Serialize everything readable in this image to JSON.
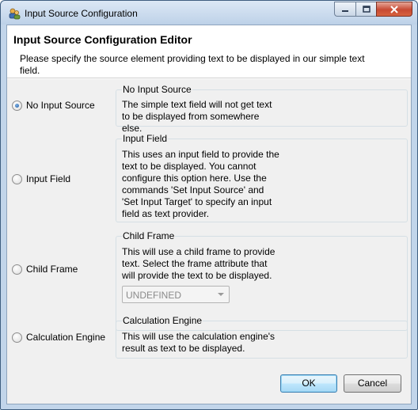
{
  "window": {
    "title": "Input Source Configuration",
    "icons": {
      "app": "app-icon",
      "minimize": "minimize-icon",
      "maximize": "maximize-icon",
      "close": "close-icon"
    }
  },
  "header": {
    "title": "Input Source Configuration Editor",
    "description": "Please specify the source element providing text to be displayed in our simple text field."
  },
  "options": [
    {
      "label": "No Input Source",
      "selected": true,
      "group_title": "No Input Source",
      "description": "The simple text field will not get text to be displayed from somewhere else."
    },
    {
      "label": "Input Field",
      "selected": false,
      "group_title": "Input Field",
      "description": "This uses an input field to provide the text to be displayed. You cannot configure this option here. Use the commands 'Set Input Source' and 'Set Input Target' to specify an input field as text provider."
    },
    {
      "label": "Child Frame",
      "selected": false,
      "group_title": "Child Frame",
      "description": "This will use a child frame to provide text. Select the frame attribute that will provide the text to be displayed.",
      "combo": {
        "value": "UNDEFINED",
        "enabled": false
      }
    },
    {
      "label": "Calculation Engine",
      "selected": false,
      "group_title": "Calculation Engine",
      "description": "This will use the calculation engine's result as text to be displayed."
    }
  ],
  "buttons": {
    "ok": "OK",
    "cancel": "Cancel"
  }
}
